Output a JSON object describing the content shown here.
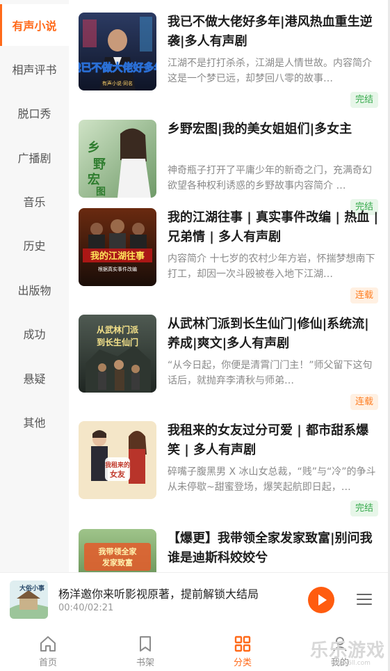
{
  "sidebar": {
    "categories": [
      {
        "label": "有声小说",
        "active": true
      },
      {
        "label": "相声评书",
        "active": false
      },
      {
        "label": "脱口秀",
        "active": false
      },
      {
        "label": "广播剧",
        "active": false
      },
      {
        "label": "音乐",
        "active": false
      },
      {
        "label": "历史",
        "active": false
      },
      {
        "label": "出版物",
        "active": false
      },
      {
        "label": "成功",
        "active": false
      },
      {
        "label": "悬疑",
        "active": false
      },
      {
        "label": "其他",
        "active": false
      }
    ]
  },
  "books": [
    {
      "title": "我已不做大佬好多年|港风热血重生逆袭|多人有声剧",
      "desc": "江湖不是打打杀杀，江湖是人情世故。内容简介 这是一个梦已远，却梦回八零的故事…",
      "status": "完结",
      "cover_text": "我已不做大佬好多年",
      "cover_sub": "有声小说·同名"
    },
    {
      "title": "乡野宏图|我的美女姐姐们|多女主",
      "desc": "神奇瓶子打开了平庸少年的新奇之门，充满奇幻欲望各种权利诱惑的乡野故事内容简介 …",
      "status": "完结",
      "cover_text": "乡野宏图"
    },
    {
      "title": "我的江湖往事 | 真实事件改编 | 热血 | 兄弟情 | 多人有声剧",
      "desc": "内容简介 十七岁的农村少年方岩，怀揣梦想南下打工，却因一次斗殴被卷入地下江湖…",
      "status": "连载",
      "cover_text": "我的江湖往事",
      "cover_sub": "根据真实事件改编"
    },
    {
      "title": "从武林门派到长生仙门|修仙|系统流|养成|爽文|多人有声剧",
      "desc": "“从今日起，你便是清霄门门主！”师父留下这句话后，就抛弃李清秋与师弟…",
      "status": "连载",
      "cover_text": "从武林门派到长生仙门"
    },
    {
      "title": "我租来的女友过分可爱 | 都市甜系爆笑 | 多人有声剧",
      "desc": "碎嘴子腹黑男 X 冰山女总裁，“贱”与“冷”的争斗从未停歇~甜蜜登场，爆笑起航即日起，…",
      "status": "完结",
      "cover_text": "我租来的女友"
    },
    {
      "title": "【爆更】我带领全家发家致富|别问我谁是迪斯科姣姣兮",
      "desc": "",
      "status": "",
      "cover_text": "我带领全家发家致富"
    }
  ],
  "player": {
    "title": "杨洋邀你来听影视原著，提前解锁大结局",
    "time": "00:40/02:21",
    "cover_text": "大俗小事"
  },
  "nav": {
    "tabs": [
      {
        "label": "首页",
        "icon": "home-icon",
        "active": false
      },
      {
        "label": "书架",
        "icon": "bookmark-icon",
        "active": false
      },
      {
        "label": "分类",
        "icon": "grid-icon",
        "active": true
      },
      {
        "label": "我的",
        "icon": "user-icon",
        "active": false
      }
    ]
  },
  "watermark": {
    "main": "乐乐游戏",
    "sub": "www.6ll.com"
  },
  "colors": {
    "accent": "#ff6a1a",
    "done": "#36a94b",
    "serial": "#ff7e22",
    "play": "#ff5c0f"
  }
}
